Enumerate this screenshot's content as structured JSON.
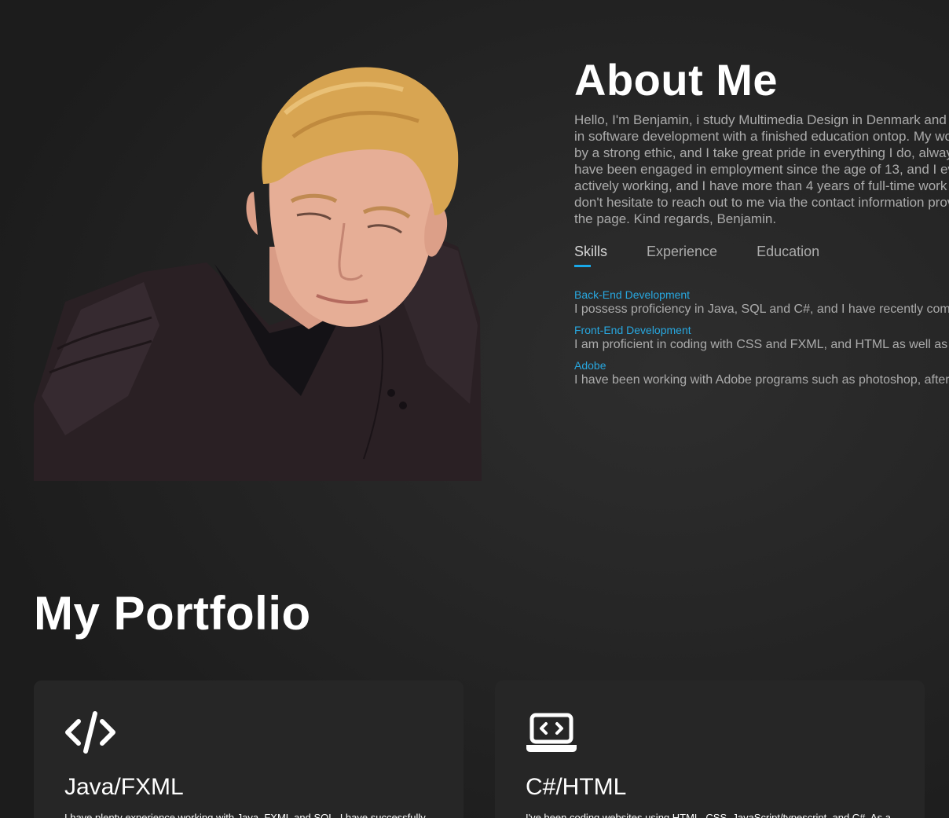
{
  "about": {
    "title": "About Me",
    "paragraph": "Hello, I'm Benjamin, i study Multimedia Design in Denmark and have a background in software development with a finished education ontop. My work is characterized by a strong ethic, and I take great pride in everything I do, always giving my best. I have been engaged in employment since the age of 13, and I ever since been actively working, and I have more than 4 years of full-time work experience. Please don't hesitate to reach out to me via the contact information provided further down the page. Kind regards, Benjamin.",
    "tabs": [
      {
        "label": "Skills"
      },
      {
        "label": "Experience"
      },
      {
        "label": "Education"
      }
    ],
    "skills": [
      {
        "title": "Back-End Development",
        "desc": "I possess proficiency in Java, SQL and C#, and I have recently completed projects in all of them."
      },
      {
        "title": "Front-End Development",
        "desc": "I am proficient in coding with CSS and FXML, and HTML as well as JavaScript and TypeScript."
      },
      {
        "title": "Adobe",
        "desc": "I have been working with Adobe programs such as photoshop, after effects and premiere pro for years."
      }
    ]
  },
  "portfolio": {
    "title": "My Portfolio",
    "cards": [
      {
        "icon": "code-icon",
        "title": "Java/FXML",
        "desc": "I have plenty experience working with Java, FXML and SQL. I have successfully"
      },
      {
        "icon": "laptop-code-icon",
        "title": "C#/HTML",
        "desc": "I've been coding websites using HTML, CSS, JavaScript/typescript, and C#. As a"
      }
    ]
  },
  "colors": {
    "accent": "#19a8e8",
    "skill_title": "#28a7df",
    "muted_text": "#ababab",
    "card_bg": "#262626"
  }
}
